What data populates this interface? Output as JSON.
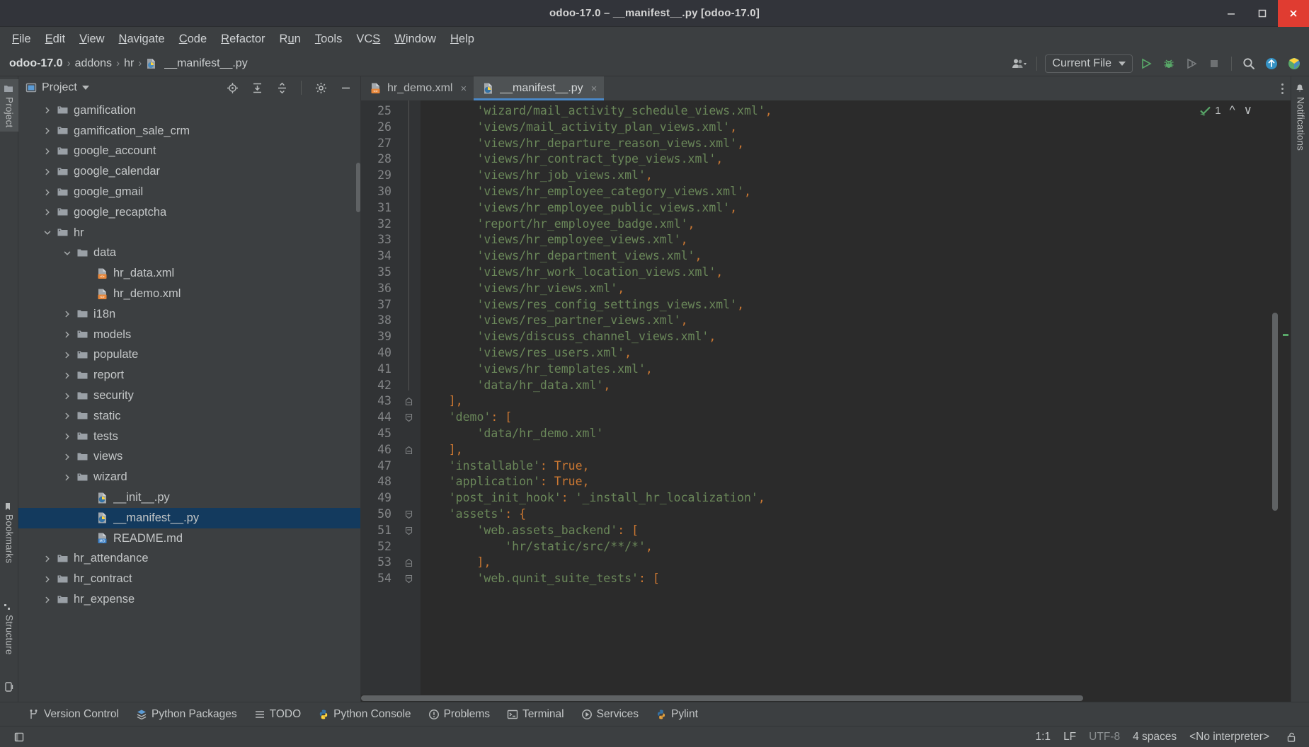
{
  "window": {
    "title": "odoo-17.0 – __manifest__.py [odoo-17.0]",
    "minimize_label": "Minimize",
    "maximize_label": "Maximize",
    "close_label": "Close"
  },
  "menubar": {
    "items": [
      {
        "label": "File",
        "mnemonic": "F"
      },
      {
        "label": "Edit",
        "mnemonic": "E"
      },
      {
        "label": "View",
        "mnemonic": "V"
      },
      {
        "label": "Navigate",
        "mnemonic": "N"
      },
      {
        "label": "Code",
        "mnemonic": "C"
      },
      {
        "label": "Refactor",
        "mnemonic": "R"
      },
      {
        "label": "Run",
        "mnemonic": "u"
      },
      {
        "label": "Tools",
        "mnemonic": "T"
      },
      {
        "label": "VCS",
        "mnemonic": "S"
      },
      {
        "label": "Window",
        "mnemonic": "W"
      },
      {
        "label": "Help",
        "mnemonic": "H"
      }
    ]
  },
  "navbar": {
    "breadcrumbs": [
      "odoo-17.0",
      "addons",
      "hr",
      "__manifest__.py"
    ],
    "separator": "›",
    "run_config": "Current File",
    "icons": [
      {
        "name": "people-icon",
        "title": "Collaborate"
      },
      {
        "name": "run-icon",
        "title": "Run"
      },
      {
        "name": "debug-icon",
        "title": "Debug"
      },
      {
        "name": "coverage-icon",
        "title": "Run with Coverage"
      },
      {
        "name": "stop-icon",
        "title": "Stop"
      },
      {
        "name": "search-icon",
        "title": "Search Everywhere"
      },
      {
        "name": "update-project-icon",
        "title": "Update Project"
      },
      {
        "name": "plugin-icon",
        "title": "Odoo"
      }
    ]
  },
  "left_stripe": {
    "project_label": "Project",
    "bookmarks_label": "Bookmarks",
    "structure_label": "Structure"
  },
  "right_stripe": {
    "notifications_label": "Notifications"
  },
  "project_panel": {
    "title": "Project",
    "actions": [
      {
        "name": "select-opened-file-icon",
        "title": "Select Opened File"
      },
      {
        "name": "expand-all-icon",
        "title": "Expand All"
      },
      {
        "name": "collapse-all-icon",
        "title": "Collapse All"
      },
      {
        "name": "settings-gear-icon",
        "title": "Options"
      },
      {
        "name": "hide-panel-icon",
        "title": "Hide"
      }
    ],
    "tree": [
      {
        "label": "gamification",
        "indent": 1,
        "type": "package",
        "state": "collapsed"
      },
      {
        "label": "gamification_sale_crm",
        "indent": 1,
        "type": "package",
        "state": "collapsed"
      },
      {
        "label": "google_account",
        "indent": 1,
        "type": "package",
        "state": "collapsed"
      },
      {
        "label": "google_calendar",
        "indent": 1,
        "type": "package",
        "state": "collapsed"
      },
      {
        "label": "google_gmail",
        "indent": 1,
        "type": "package",
        "state": "collapsed"
      },
      {
        "label": "google_recaptcha",
        "indent": 1,
        "type": "package",
        "state": "collapsed"
      },
      {
        "label": "hr",
        "indent": 1,
        "type": "package",
        "state": "expanded"
      },
      {
        "label": "data",
        "indent": 2,
        "type": "folder",
        "state": "expanded"
      },
      {
        "label": "hr_data.xml",
        "indent": 3,
        "type": "xml",
        "state": "leaf"
      },
      {
        "label": "hr_demo.xml",
        "indent": 3,
        "type": "xml",
        "state": "leaf"
      },
      {
        "label": "i18n",
        "indent": 2,
        "type": "folder",
        "state": "collapsed"
      },
      {
        "label": "models",
        "indent": 2,
        "type": "package",
        "state": "collapsed"
      },
      {
        "label": "populate",
        "indent": 2,
        "type": "package",
        "state": "collapsed"
      },
      {
        "label": "report",
        "indent": 2,
        "type": "folder",
        "state": "collapsed"
      },
      {
        "label": "security",
        "indent": 2,
        "type": "folder",
        "state": "collapsed"
      },
      {
        "label": "static",
        "indent": 2,
        "type": "folder",
        "state": "collapsed"
      },
      {
        "label": "tests",
        "indent": 2,
        "type": "package",
        "state": "collapsed"
      },
      {
        "label": "views",
        "indent": 2,
        "type": "folder",
        "state": "collapsed"
      },
      {
        "label": "wizard",
        "indent": 2,
        "type": "package",
        "state": "collapsed"
      },
      {
        "label": "__init__.py",
        "indent": 3,
        "type": "python",
        "state": "leaf"
      },
      {
        "label": "__manifest__.py",
        "indent": 3,
        "type": "python",
        "state": "leaf",
        "selected": true
      },
      {
        "label": "README.md",
        "indent": 3,
        "type": "markdown",
        "state": "leaf"
      },
      {
        "label": "hr_attendance",
        "indent": 1,
        "type": "package",
        "state": "collapsed"
      },
      {
        "label": "hr_contract",
        "indent": 1,
        "type": "package",
        "state": "collapsed"
      },
      {
        "label": "hr_expense",
        "indent": 1,
        "type": "package",
        "state": "collapsed"
      }
    ]
  },
  "editor": {
    "tabs": [
      {
        "label": "hr_demo.xml",
        "type": "xml",
        "active": false,
        "close": "×"
      },
      {
        "label": "__manifest__.py",
        "type": "python",
        "active": true,
        "close": "×"
      }
    ],
    "inspection": {
      "count": "1",
      "up": "⌃",
      "down": "⌄"
    },
    "first_line_number": 25,
    "lines": [
      {
        "n": 25,
        "indent": 8,
        "text": "'wizard/mail_activity_schedule_views.xml'",
        "comma": true,
        "fold": null
      },
      {
        "n": 26,
        "indent": 8,
        "text": "'views/mail_activity_plan_views.xml'",
        "comma": true,
        "fold": null
      },
      {
        "n": 27,
        "indent": 8,
        "text": "'views/hr_departure_reason_views.xml'",
        "comma": true,
        "fold": null
      },
      {
        "n": 28,
        "indent": 8,
        "text": "'views/hr_contract_type_views.xml'",
        "comma": true,
        "fold": null
      },
      {
        "n": 29,
        "indent": 8,
        "text": "'views/hr_job_views.xml'",
        "comma": true,
        "fold": null
      },
      {
        "n": 30,
        "indent": 8,
        "text": "'views/hr_employee_category_views.xml'",
        "comma": true,
        "fold": null
      },
      {
        "n": 31,
        "indent": 8,
        "text": "'views/hr_employee_public_views.xml'",
        "comma": true,
        "fold": null
      },
      {
        "n": 32,
        "indent": 8,
        "text": "'report/hr_employee_badge.xml'",
        "comma": true,
        "fold": null
      },
      {
        "n": 33,
        "indent": 8,
        "text": "'views/hr_employee_views.xml'",
        "comma": true,
        "fold": null
      },
      {
        "n": 34,
        "indent": 8,
        "text": "'views/hr_department_views.xml'",
        "comma": true,
        "fold": null
      },
      {
        "n": 35,
        "indent": 8,
        "text": "'views/hr_work_location_views.xml'",
        "comma": true,
        "fold": null
      },
      {
        "n": 36,
        "indent": 8,
        "text": "'views/hr_views.xml'",
        "comma": true,
        "fold": null
      },
      {
        "n": 37,
        "indent": 8,
        "text": "'views/res_config_settings_views.xml'",
        "comma": true,
        "fold": null
      },
      {
        "n": 38,
        "indent": 8,
        "text": "'views/res_partner_views.xml'",
        "comma": true,
        "fold": null
      },
      {
        "n": 39,
        "indent": 8,
        "text": "'views/discuss_channel_views.xml'",
        "comma": true,
        "fold": null
      },
      {
        "n": 40,
        "indent": 8,
        "text": "'views/res_users.xml'",
        "comma": true,
        "fold": null
      },
      {
        "n": 41,
        "indent": 8,
        "text": "'views/hr_templates.xml'",
        "comma": true,
        "fold": null
      },
      {
        "n": 42,
        "indent": 8,
        "text": "'data/hr_data.xml'",
        "comma": true,
        "fold": null
      },
      {
        "n": 43,
        "indent": 4,
        "text": "]",
        "comma": true,
        "fold": "end"
      },
      {
        "n": 44,
        "indent": 4,
        "text": "'demo': [",
        "comma": false,
        "fold": "start"
      },
      {
        "n": 45,
        "indent": 8,
        "text": "'data/hr_demo.xml'",
        "comma": false,
        "fold": null
      },
      {
        "n": 46,
        "indent": 4,
        "text": "]",
        "comma": true,
        "fold": "end"
      },
      {
        "n": 47,
        "indent": 4,
        "text": "'installable': True",
        "comma": true,
        "fold": null
      },
      {
        "n": 48,
        "indent": 4,
        "text": "'application': True",
        "comma": true,
        "fold": null
      },
      {
        "n": 49,
        "indent": 4,
        "text": "'post_init_hook': '_install_hr_localization'",
        "comma": true,
        "fold": null
      },
      {
        "n": 50,
        "indent": 4,
        "text": "'assets': {",
        "comma": false,
        "fold": "start"
      },
      {
        "n": 51,
        "indent": 8,
        "text": "'web.assets_backend': [",
        "comma": false,
        "fold": "start"
      },
      {
        "n": 52,
        "indent": 12,
        "text": "'hr/static/src/**/*'",
        "comma": true,
        "fold": null
      },
      {
        "n": 53,
        "indent": 8,
        "text": "]",
        "comma": true,
        "fold": "end"
      },
      {
        "n": 54,
        "indent": 8,
        "text": "'web.qunit_suite_tests': [",
        "comma": false,
        "fold": "start"
      }
    ]
  },
  "tool_window_bar": {
    "items": [
      {
        "label": "Version Control",
        "icon": "branch-icon"
      },
      {
        "label": "Python Packages",
        "icon": "packages-icon"
      },
      {
        "label": "TODO",
        "icon": "list-icon"
      },
      {
        "label": "Python Console",
        "icon": "python-icon"
      },
      {
        "label": "Problems",
        "icon": "problems-icon"
      },
      {
        "label": "Terminal",
        "icon": "terminal-icon"
      },
      {
        "label": "Services",
        "icon": "services-icon"
      },
      {
        "label": "Pylint",
        "icon": "pylint-icon"
      }
    ]
  },
  "statusbar": {
    "caret": "1:1",
    "line_separator": "LF",
    "encoding": "UTF-8",
    "indent": "4 spaces",
    "interpreter": "<No interpreter>",
    "lock_icon": "unlocked-lock-icon"
  },
  "colors": {
    "accent_blue": "#4a88c7",
    "selection_blue": "#133a5e",
    "string_green": "#6a8759",
    "punct_orange": "#cc7832",
    "editor_bg": "#2b2b2b",
    "panel_bg": "#3c3f41",
    "close_red": "#e03c31",
    "run_green": "#59a869"
  }
}
